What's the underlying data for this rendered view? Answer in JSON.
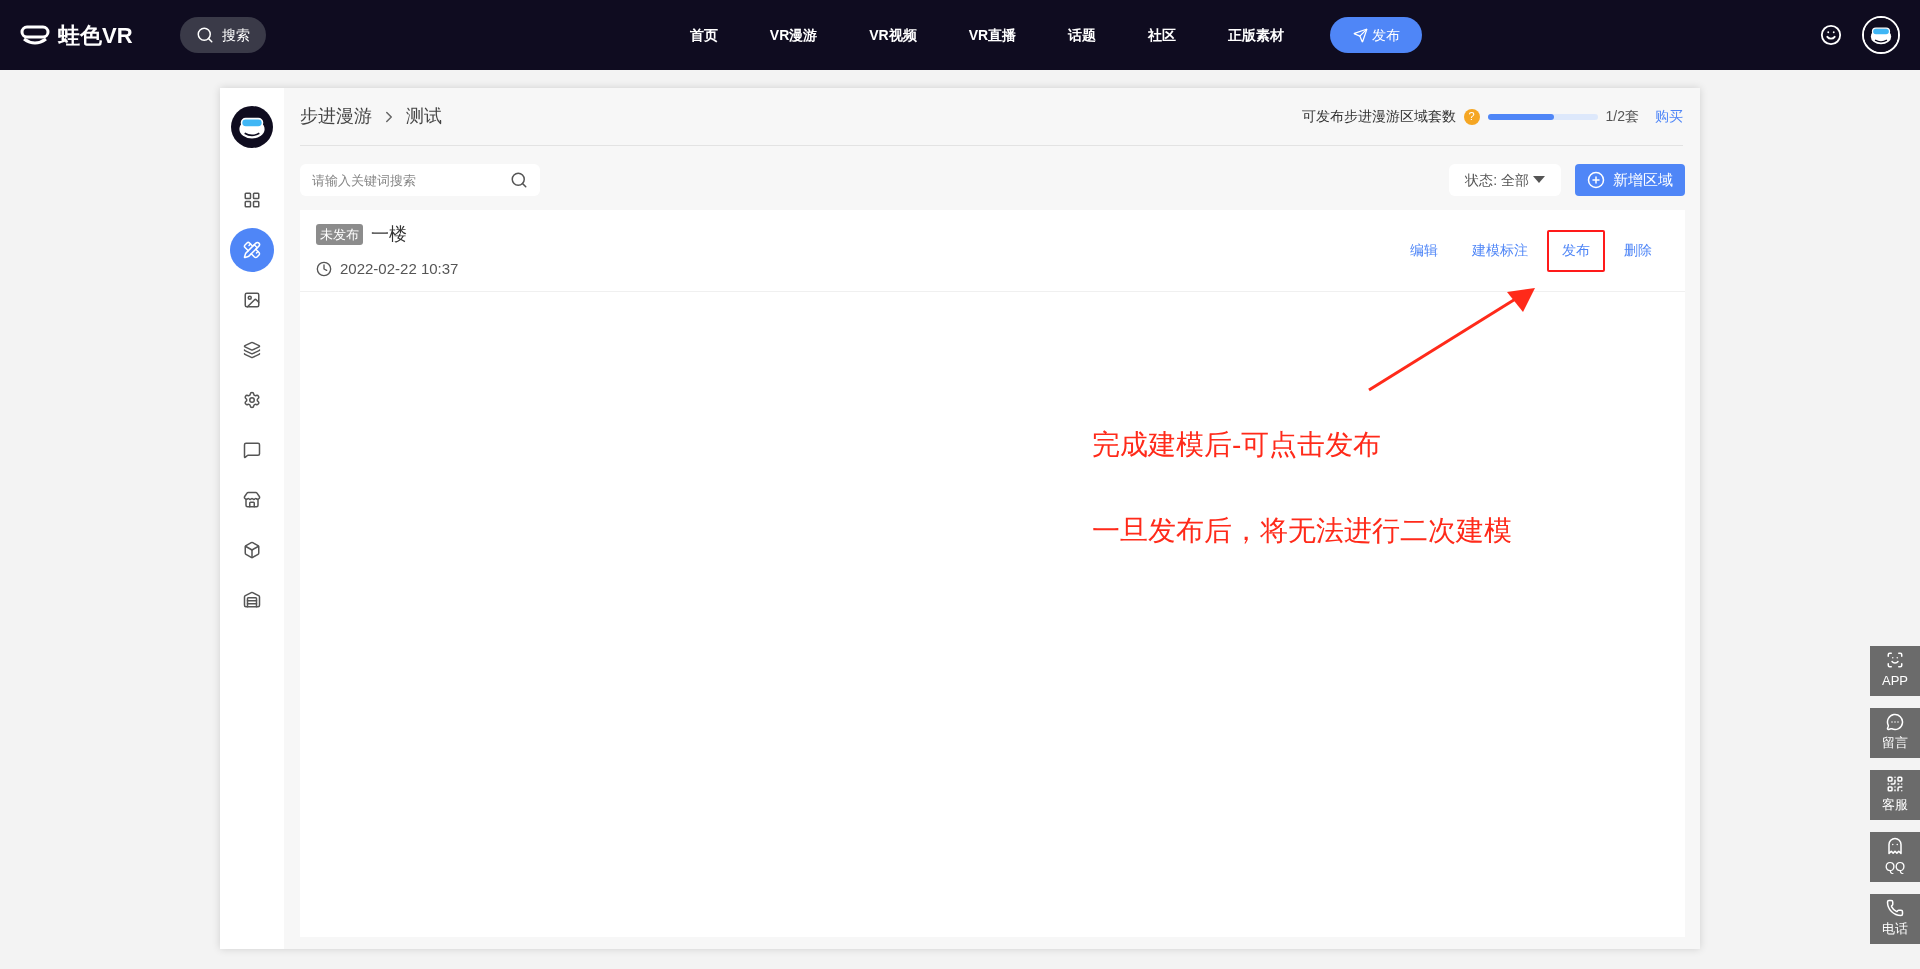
{
  "topbar": {
    "logo": "蛙色VR",
    "search": "搜索",
    "nav": [
      {
        "label": "首页",
        "selected": false
      },
      {
        "label": "VR漫游",
        "selected": false
      },
      {
        "label": "VR视频",
        "selected": false
      },
      {
        "label": "VR直播",
        "selected": false
      },
      {
        "label": "话题",
        "selected": false
      },
      {
        "label": "社区",
        "selected": false
      },
      {
        "label": "正版素材",
        "selected": false
      }
    ],
    "publish": "发布"
  },
  "sidebar": {
    "items": [
      {
        "kind": "grid",
        "selected": false
      },
      {
        "kind": "tools",
        "selected": true
      },
      {
        "kind": "image",
        "selected": false
      },
      {
        "kind": "layers",
        "selected": false
      },
      {
        "kind": "settings",
        "selected": false
      },
      {
        "kind": "message",
        "selected": false
      },
      {
        "kind": "store",
        "selected": false
      },
      {
        "kind": "box",
        "selected": false
      },
      {
        "kind": "home",
        "selected": false
      }
    ]
  },
  "breadcrumb": [
    "步进漫游",
    "测试"
  ],
  "quota": {
    "label": "可发布步进漫游区域套数",
    "help": "?",
    "level": 0.6,
    "reading": "1/2套",
    "buy": "购买"
  },
  "search": {
    "placeholder": "请输入关键词搜索"
  },
  "filter": {
    "label": "状态:",
    "value": "全部"
  },
  "add_button": "新增区域",
  "rows": [
    {
      "tag": "未发布",
      "title": "一楼",
      "time": "2022-02-22 10:37",
      "actions": [
        {
          "label": "编辑",
          "annotated": false
        },
        {
          "label": "建模标注",
          "annotated": false
        },
        {
          "label": "发布",
          "annotated": true
        },
        {
          "label": "删除",
          "annotated": false
        }
      ]
    }
  ],
  "annotation": [
    "完成建模后-可点击发布",
    "一旦发布后，将无法进行二次建模"
  ],
  "float_buttons": [
    {
      "kind": "app",
      "label": "APP"
    },
    {
      "kind": "chat",
      "label": "留言"
    },
    {
      "kind": "qr",
      "label": "客服"
    },
    {
      "kind": "qq",
      "label": "QQ"
    },
    {
      "kind": "phone",
      "label": "电话"
    }
  ]
}
